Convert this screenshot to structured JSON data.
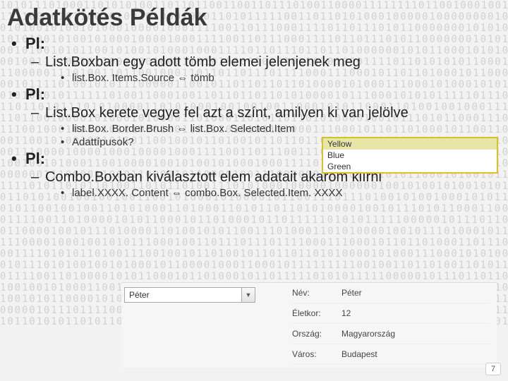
{
  "title": "Adatkötés Példák",
  "arrow": "⇔",
  "sections": [
    {
      "label": "Pl:",
      "desc": "List.Boxban egy adott tömb elemei jelenjenek meg",
      "details": [
        "list.Box. Items.Source ⇔ tömb"
      ]
    },
    {
      "label": "Pl:",
      "desc": "List.Box kerete vegye fel azt a színt, amilyen ki van jelölve",
      "details": [
        "list.Box. Border.Brush ⇔ list.Box. Selected.Item",
        "Adattípusok?"
      ]
    },
    {
      "label": "Pl:",
      "desc": "Combo.Boxban kiválasztott elem adatait akarom kiírni",
      "details": [
        "label.XXXX. Content ⇔ combo.Box. Selected.Item. XXXX"
      ]
    }
  ],
  "listbox": {
    "selected": "Yellow",
    "options": [
      "Blue",
      "Green"
    ]
  },
  "combo": {
    "value": "Péter"
  },
  "form": {
    "rows": [
      {
        "label": "Név:",
        "value": "Péter"
      },
      {
        "label": "Életkor:",
        "value": "12"
      },
      {
        "label": "Ország:",
        "value": "Magyarország"
      },
      {
        "label": "Város:",
        "value": "Budapest"
      }
    ]
  },
  "page": "7"
}
